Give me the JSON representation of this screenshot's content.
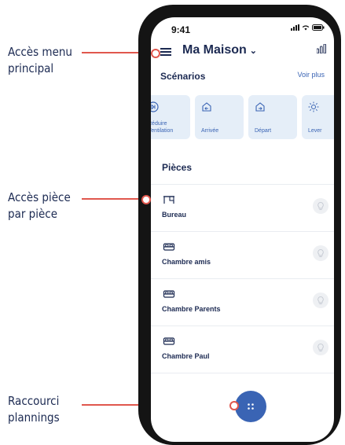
{
  "annotations": [
    {
      "line1": "Accès menu",
      "line2": "principal"
    },
    {
      "line1": "Accès pièce",
      "line2": "par pièce"
    },
    {
      "line1": "Raccourci",
      "line2": "plannings"
    }
  ],
  "status_bar": {
    "time": "9:41"
  },
  "header": {
    "house_name": "Ma Maison",
    "chevron": "⌄"
  },
  "scenarios": {
    "title": "Scénarios",
    "see_more": "Voir plus",
    "items": [
      {
        "label": "Réduire Ventilation",
        "icon": "skip-circle-icon"
      },
      {
        "label": "Arrivée",
        "icon": "home-enter-icon"
      },
      {
        "label": "Départ",
        "icon": "home-leave-icon"
      },
      {
        "label": "Lever",
        "icon": "sun-icon"
      }
    ]
  },
  "rooms": {
    "title": "Pièces",
    "items": [
      {
        "name": "Bureau",
        "icon": "desk-icon"
      },
      {
        "name": "Chambre amis",
        "icon": "bed-icon"
      },
      {
        "name": "Chambre Parents",
        "icon": "bed-icon"
      },
      {
        "name": "Chambre Paul",
        "icon": "bed-icon"
      }
    ]
  },
  "colors": {
    "accent": "#3a64b4",
    "annotation": "#e0574d",
    "tile_bg": "#e5eef8",
    "text": "#1c2a52"
  }
}
